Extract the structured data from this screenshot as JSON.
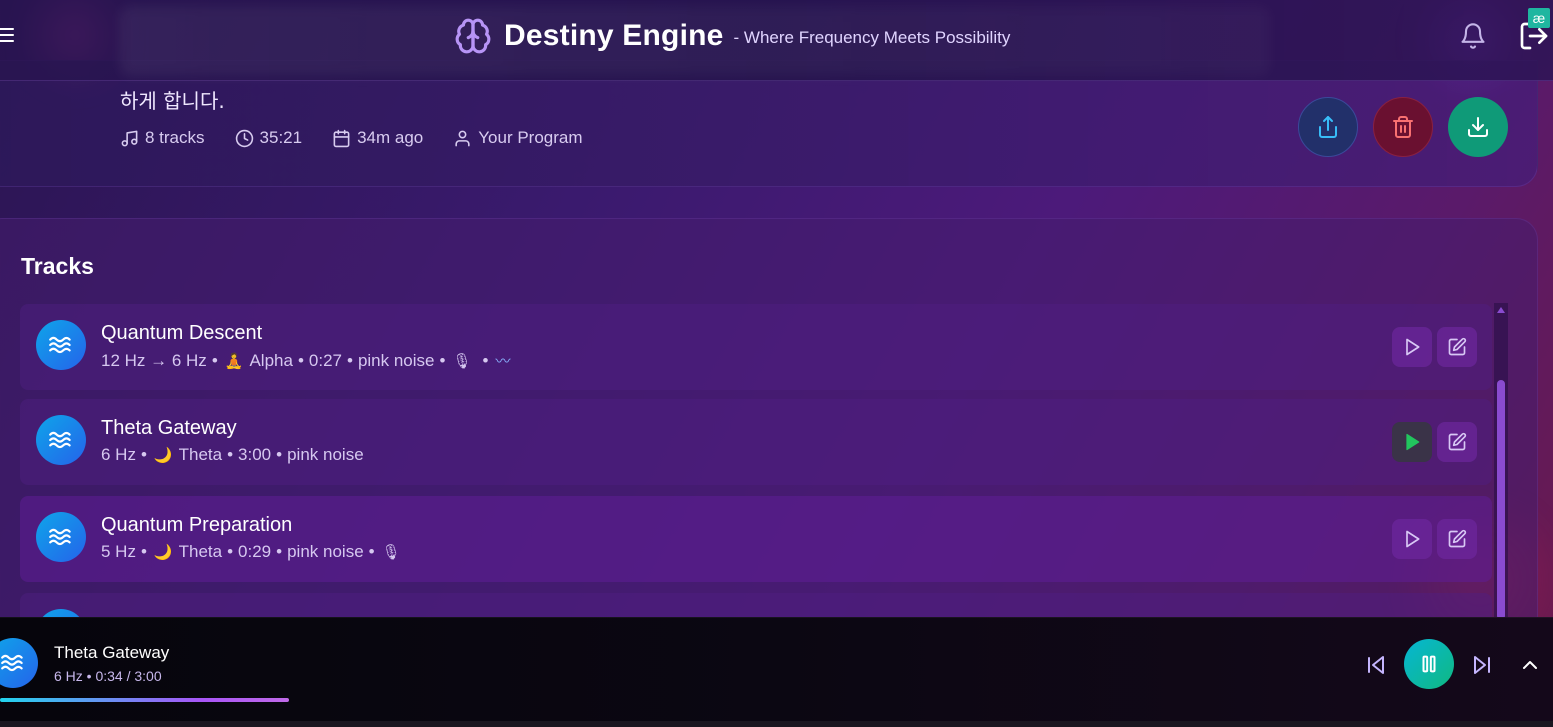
{
  "header": {
    "title": "Destiny Engine",
    "tagline": "- Where Frequency Meets Possibility",
    "badge": "æ"
  },
  "program": {
    "description_tail": "하게 합니다.",
    "meta": {
      "tracks": "8 tracks",
      "duration": "35:21",
      "created": "34m ago",
      "owner": "Your Program"
    }
  },
  "tracks_section": {
    "title": "Tracks",
    "items": [
      {
        "name": "Quantum Descent",
        "freq": "12 Hz → 6 Hz",
        "state_emoji": "🧘",
        "state": "Alpha",
        "duration": "0:27",
        "noise": "pink noise",
        "extras": [
          "🎙",
          "〰"
        ],
        "playing": false
      },
      {
        "name": "Theta Gateway",
        "freq": "6 Hz",
        "state_emoji": "🌙",
        "state": "Theta",
        "duration": "3:00",
        "noise": "pink noise",
        "extras": [],
        "playing": true
      },
      {
        "name": "Quantum Preparation",
        "freq": "5 Hz",
        "state_emoji": "🌙",
        "state": "Theta",
        "duration": "0:29",
        "noise": "pink noise",
        "extras": [
          "🎙"
        ],
        "playing": false
      }
    ]
  },
  "player": {
    "title": "Theta Gateway",
    "subtitle": "6 Hz • 0:34 / 3:00",
    "progress": 0.186
  },
  "colors": {
    "accent_teal": "#10b981",
    "accent_cyan": "#06b6d4",
    "danger": "#ef4444",
    "brand_purple": "#a78bfa"
  }
}
